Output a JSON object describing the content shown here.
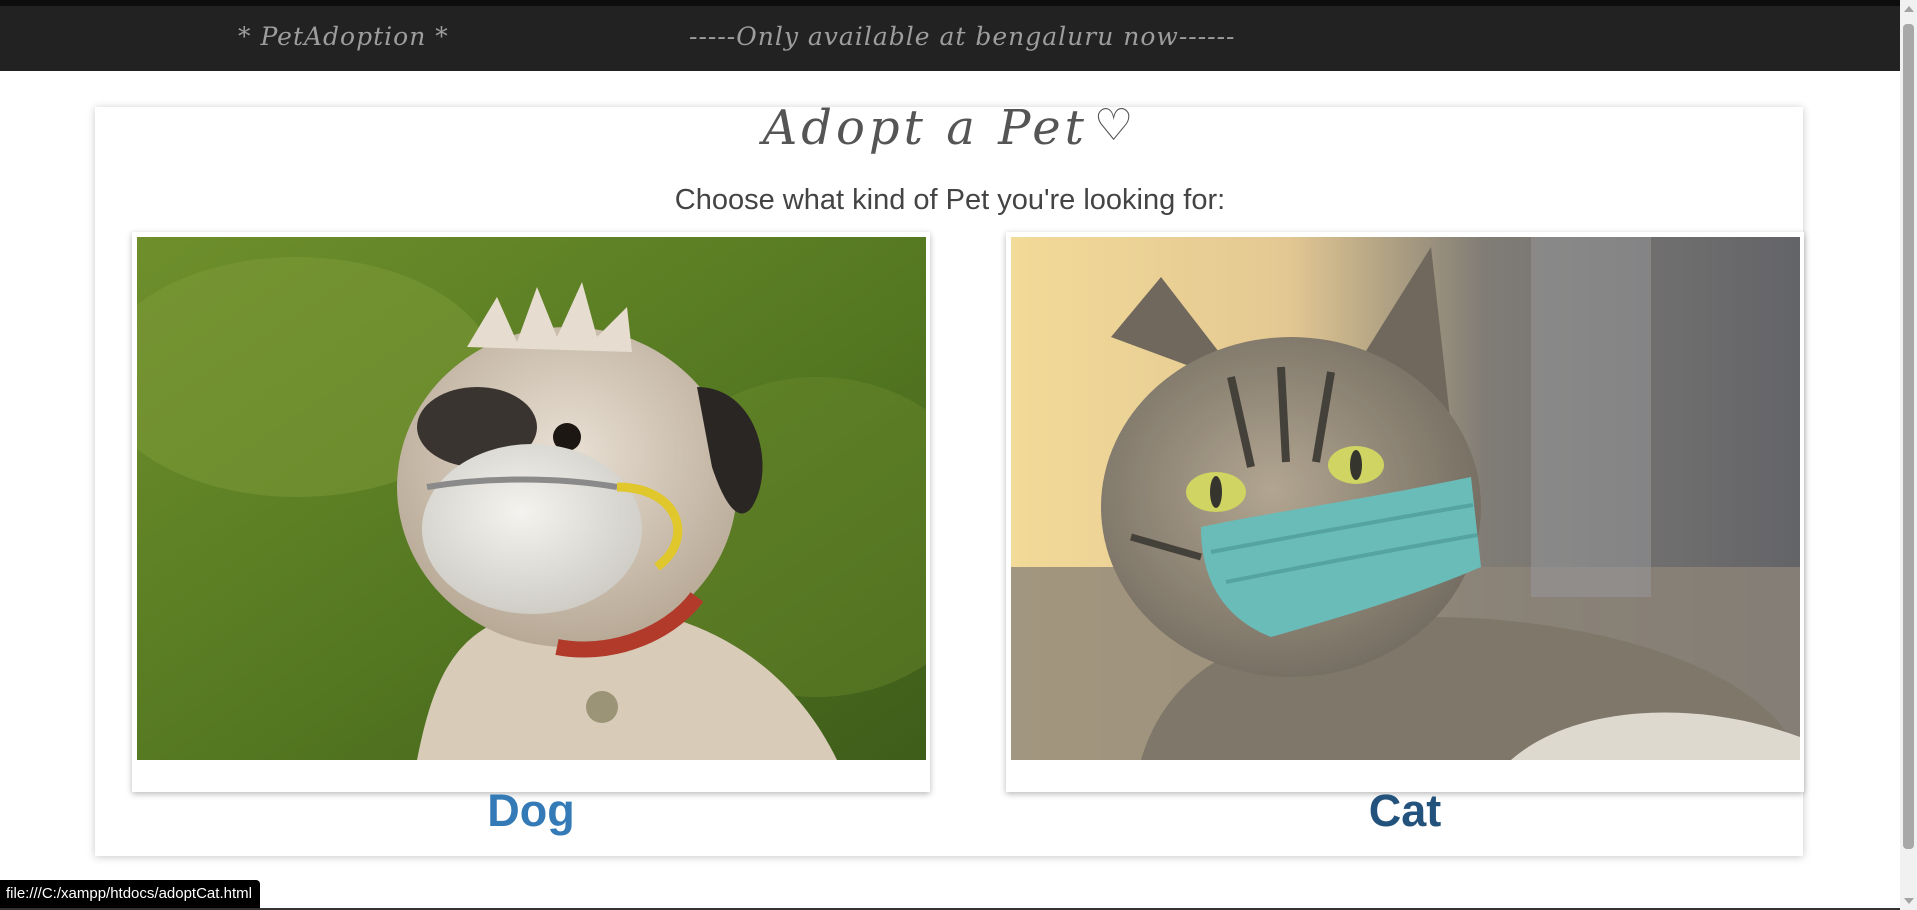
{
  "navbar": {
    "brand": "* PetAdoption *",
    "notice": "-----Only available at bengaluru now------"
  },
  "main": {
    "title": "Adopt a Pet",
    "title_icon": "heart-outline-icon",
    "heart_glyph": "♡",
    "subtitle": "Choose what kind of Pet you're looking for:",
    "cards": [
      {
        "label": "Dog",
        "image": "dog-wearing-mask-photo"
      },
      {
        "label": "Cat",
        "image": "cat-wearing-mask-photo"
      }
    ]
  },
  "status_bar": {
    "url": "file:///C:/xampp/htdocs/adoptCat.html"
  },
  "colors": {
    "navbar_bg": "#222222",
    "navbar_text": "#9d9d9d",
    "link": "#337ab7",
    "link_hover": "#23527c"
  }
}
